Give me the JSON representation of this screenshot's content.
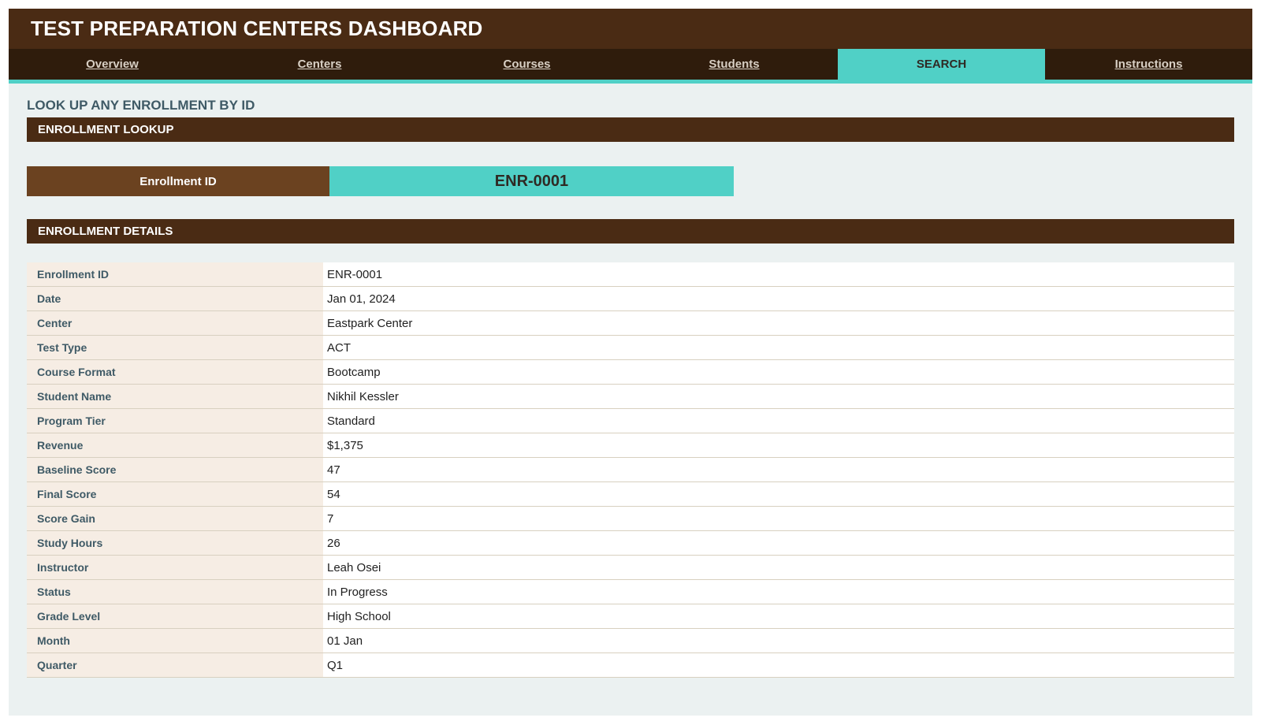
{
  "header": {
    "title": "TEST PREPARATION CENTERS DASHBOARD"
  },
  "nav": {
    "tabs": [
      {
        "label": "Overview",
        "active": false
      },
      {
        "label": "Centers",
        "active": false
      },
      {
        "label": "Courses",
        "active": false
      },
      {
        "label": "Students",
        "active": false
      },
      {
        "label": "SEARCH",
        "active": true
      },
      {
        "label": "Instructions",
        "active": false
      }
    ]
  },
  "page": {
    "subtitle": "LOOK UP ANY ENROLLMENT BY ID"
  },
  "lookup": {
    "section_title": "ENROLLMENT LOOKUP",
    "label": "Enrollment ID",
    "value": "ENR-0001"
  },
  "details": {
    "section_title": "ENROLLMENT DETAILS",
    "rows": [
      {
        "key": "Enrollment ID",
        "value": "ENR-0001"
      },
      {
        "key": "Date",
        "value": "Jan 01, 2024"
      },
      {
        "key": "Center",
        "value": "Eastpark Center"
      },
      {
        "key": "Test Type",
        "value": "ACT"
      },
      {
        "key": "Course Format",
        "value": "Bootcamp"
      },
      {
        "key": "Student Name",
        "value": "Nikhil Kessler"
      },
      {
        "key": "Program Tier",
        "value": "Standard"
      },
      {
        "key": "Revenue",
        "value": "$1,375"
      },
      {
        "key": "Baseline Score",
        "value": "47"
      },
      {
        "key": "Final Score",
        "value": "54"
      },
      {
        "key": "Score Gain",
        "value": "7"
      },
      {
        "key": "Study Hours",
        "value": "26"
      },
      {
        "key": "Instructor",
        "value": "Leah Osei"
      },
      {
        "key": "Status",
        "value": "In Progress"
      },
      {
        "key": "Grade Level",
        "value": "High School"
      },
      {
        "key": "Month",
        "value": "01 Jan"
      },
      {
        "key": "Quarter",
        "value": "Q1"
      }
    ]
  },
  "colors": {
    "header_brown": "#4a2b14",
    "nav_dark": "#2f1c0c",
    "accent_teal": "#50d0c6",
    "label_brown": "#6b4220",
    "background": "#ebf1f1",
    "key_cell": "#f6ede4"
  }
}
